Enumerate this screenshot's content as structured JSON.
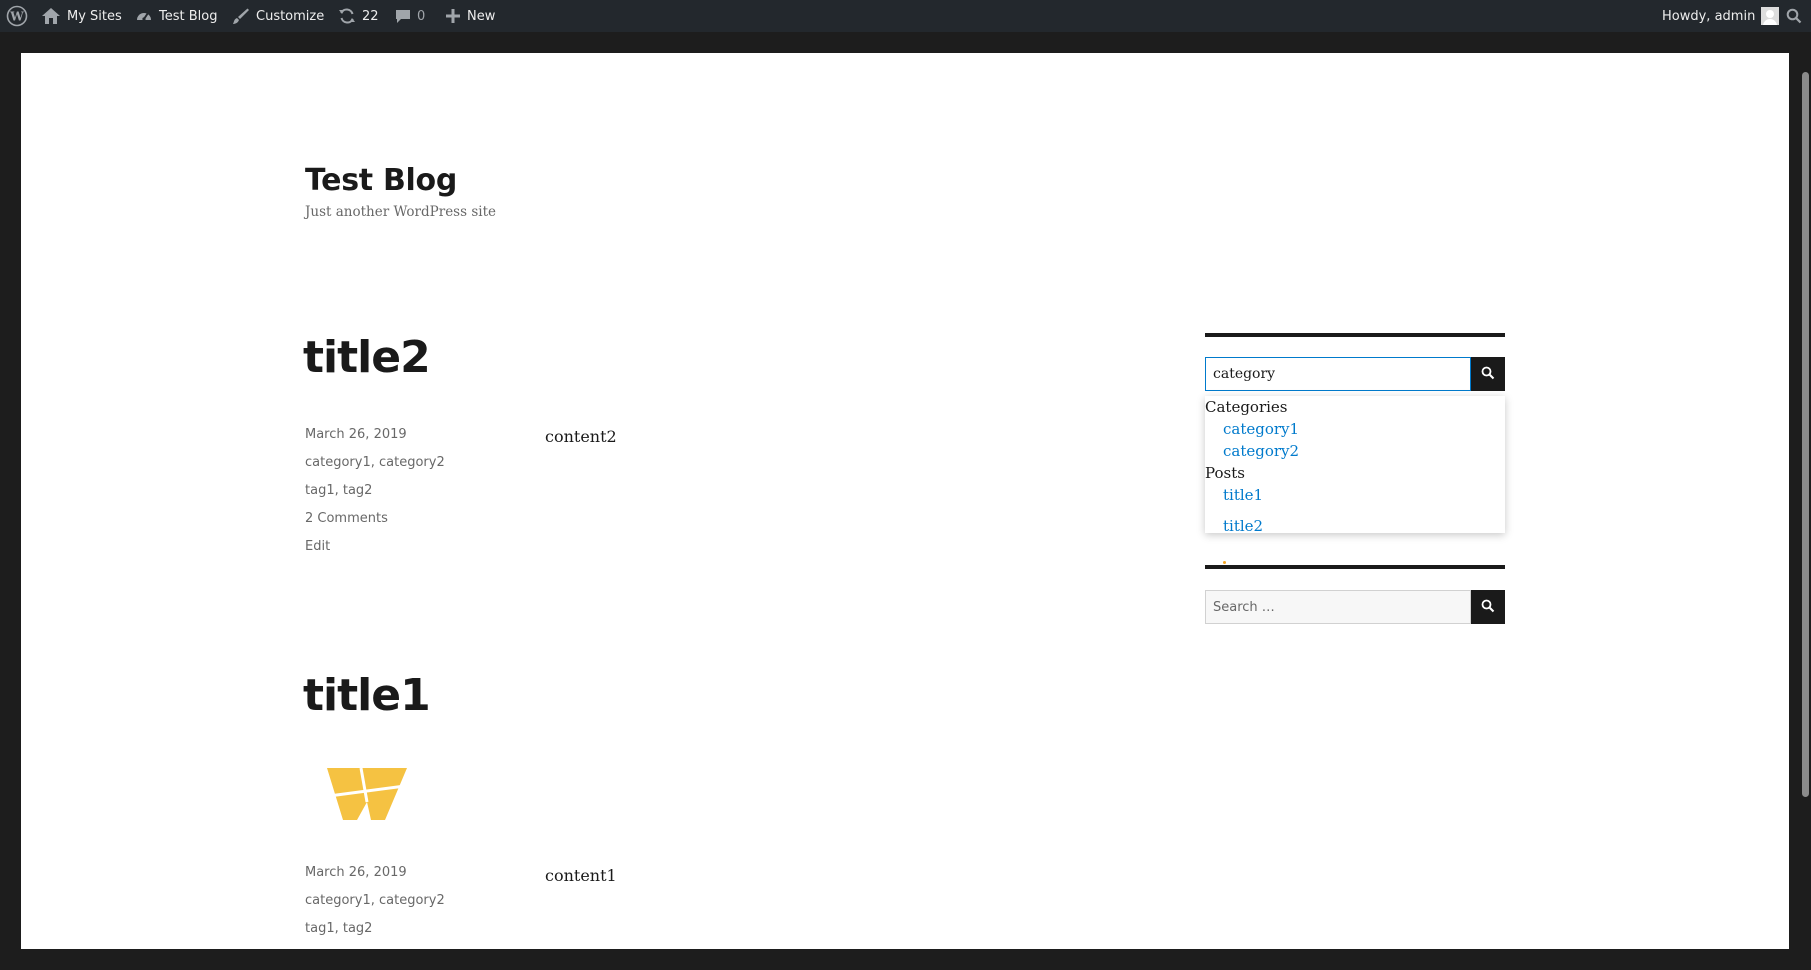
{
  "adminbar": {
    "my_sites": "My Sites",
    "site_name": "Test Blog",
    "customize": "Customize",
    "updates_count": "22",
    "comments_count": "0",
    "new_label": "New",
    "howdy": "Howdy, admin"
  },
  "site": {
    "title": "Test Blog",
    "description": "Just another WordPress site"
  },
  "posts": [
    {
      "title": "title2",
      "date": "March 26, 2019",
      "category1": "category1",
      "category2": "category2",
      "tag1": "tag1",
      "tag2": "tag2",
      "comments": "2 Comments",
      "edit": "Edit",
      "content": "content2"
    },
    {
      "title": "title1",
      "date": "March 26, 2019",
      "category1": "category1",
      "category2": "category2",
      "tag1": "tag1",
      "tag2": "tag2",
      "content": "content1"
    }
  ],
  "sidebar": {
    "search1": {
      "value": "category"
    },
    "suggestions": {
      "categories_heading": "Categories",
      "categories": [
        "category1",
        "category2"
      ],
      "posts_heading": "Posts",
      "posts": [
        "title1",
        "title2"
      ]
    },
    "search2": {
      "placeholder": "Search …"
    }
  },
  "icons": {
    "wp_logo": "wordpress-logo-icon",
    "my_sites": "my-sites-icon",
    "dashboard": "dashboard-icon",
    "customize": "brush-icon",
    "updates": "refresh-icon",
    "comments": "comment-icon",
    "new": "plus-icon",
    "search": "search-icon",
    "post_thumbnail": "w-logo-icon"
  },
  "colors": {
    "adminbar_bg": "#23282d",
    "link": "#007acc",
    "text": "#1a1a1a",
    "meta": "#686868",
    "logo_yellow": "#f5c242"
  }
}
